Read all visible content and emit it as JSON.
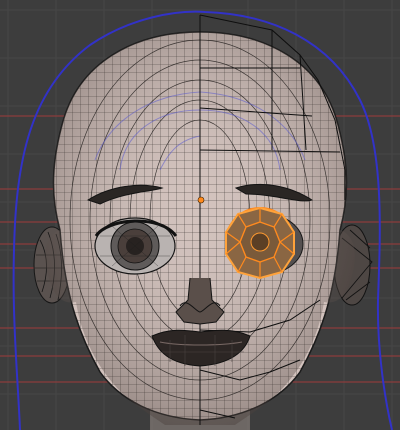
{
  "viewport": {
    "background_color": "#3d3d3d",
    "grid_color": "#4a4a4a",
    "guide_line_color": "#c04040",
    "guide_outline_color": "#3030c8",
    "mesh_fill_color": "#d2c2bd",
    "wire_color": "#111111",
    "selection_color": "#ff8a1e"
  },
  "scene": {
    "mode": "edit-mode-wireframe",
    "object": "head-mesh",
    "selected_component": "eye",
    "pivot_icon": "origin-dot-icon"
  }
}
